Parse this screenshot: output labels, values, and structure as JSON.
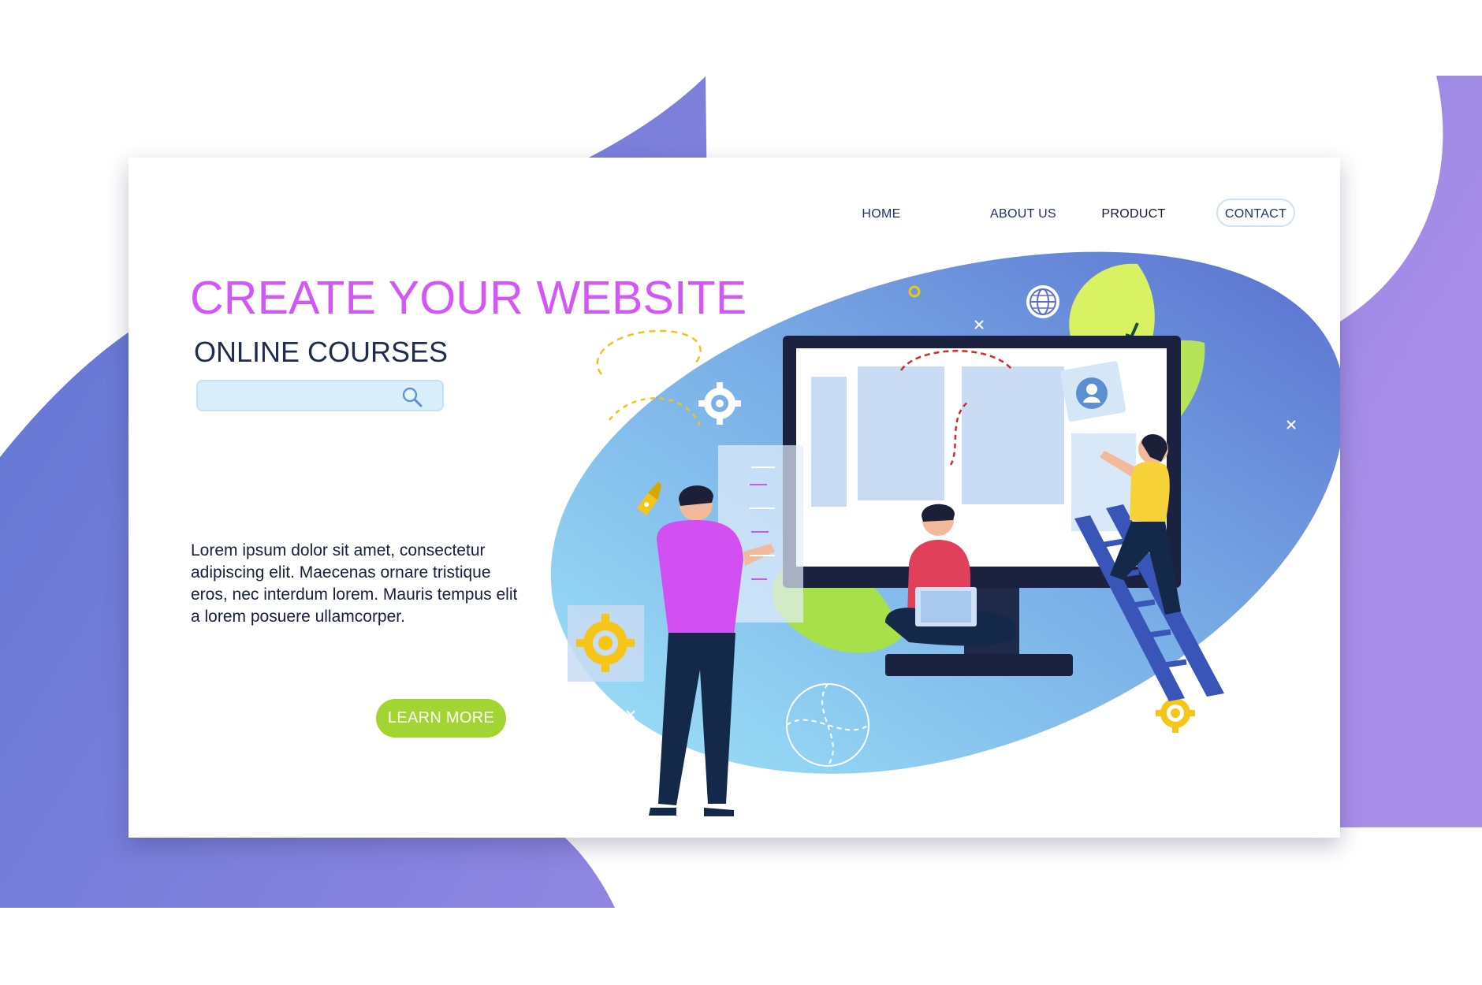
{
  "nav": {
    "items": [
      {
        "label": "HOME"
      },
      {
        "label": "ABOUT US"
      },
      {
        "label": "PRODUCT"
      },
      {
        "label": "CONTACT"
      }
    ]
  },
  "hero": {
    "title": "CREATE YOUR WEBSITE",
    "subtitle": "ONLINE COURSES",
    "search": {
      "placeholder": "",
      "value": "",
      "icon": "search-icon"
    },
    "body": "Lorem ipsum dolor sit amet, consectetur adipiscing elit. Maecenas ornare tristique eros, nec interdum lorem. Mauris tempus elit a lorem posuere ullamcorper.",
    "cta_label": "LEARN MORE"
  },
  "colors": {
    "title": "#d357f6",
    "subtitle": "#1f2d4d",
    "nav_text": "#1f3262",
    "cta": "#a2d531",
    "search_fill": "#d9eefb",
    "background_gradient_start": "#5c75d1",
    "background_gradient_end": "#a98ee9"
  },
  "illustration": {
    "icons": [
      "globe-icon",
      "gear-icon",
      "user-avatar-icon",
      "pen-tool-icon",
      "close-icon",
      "ring-icon"
    ],
    "figures": [
      "man-pointing",
      "man-with-laptop",
      "man-on-ladder"
    ]
  }
}
